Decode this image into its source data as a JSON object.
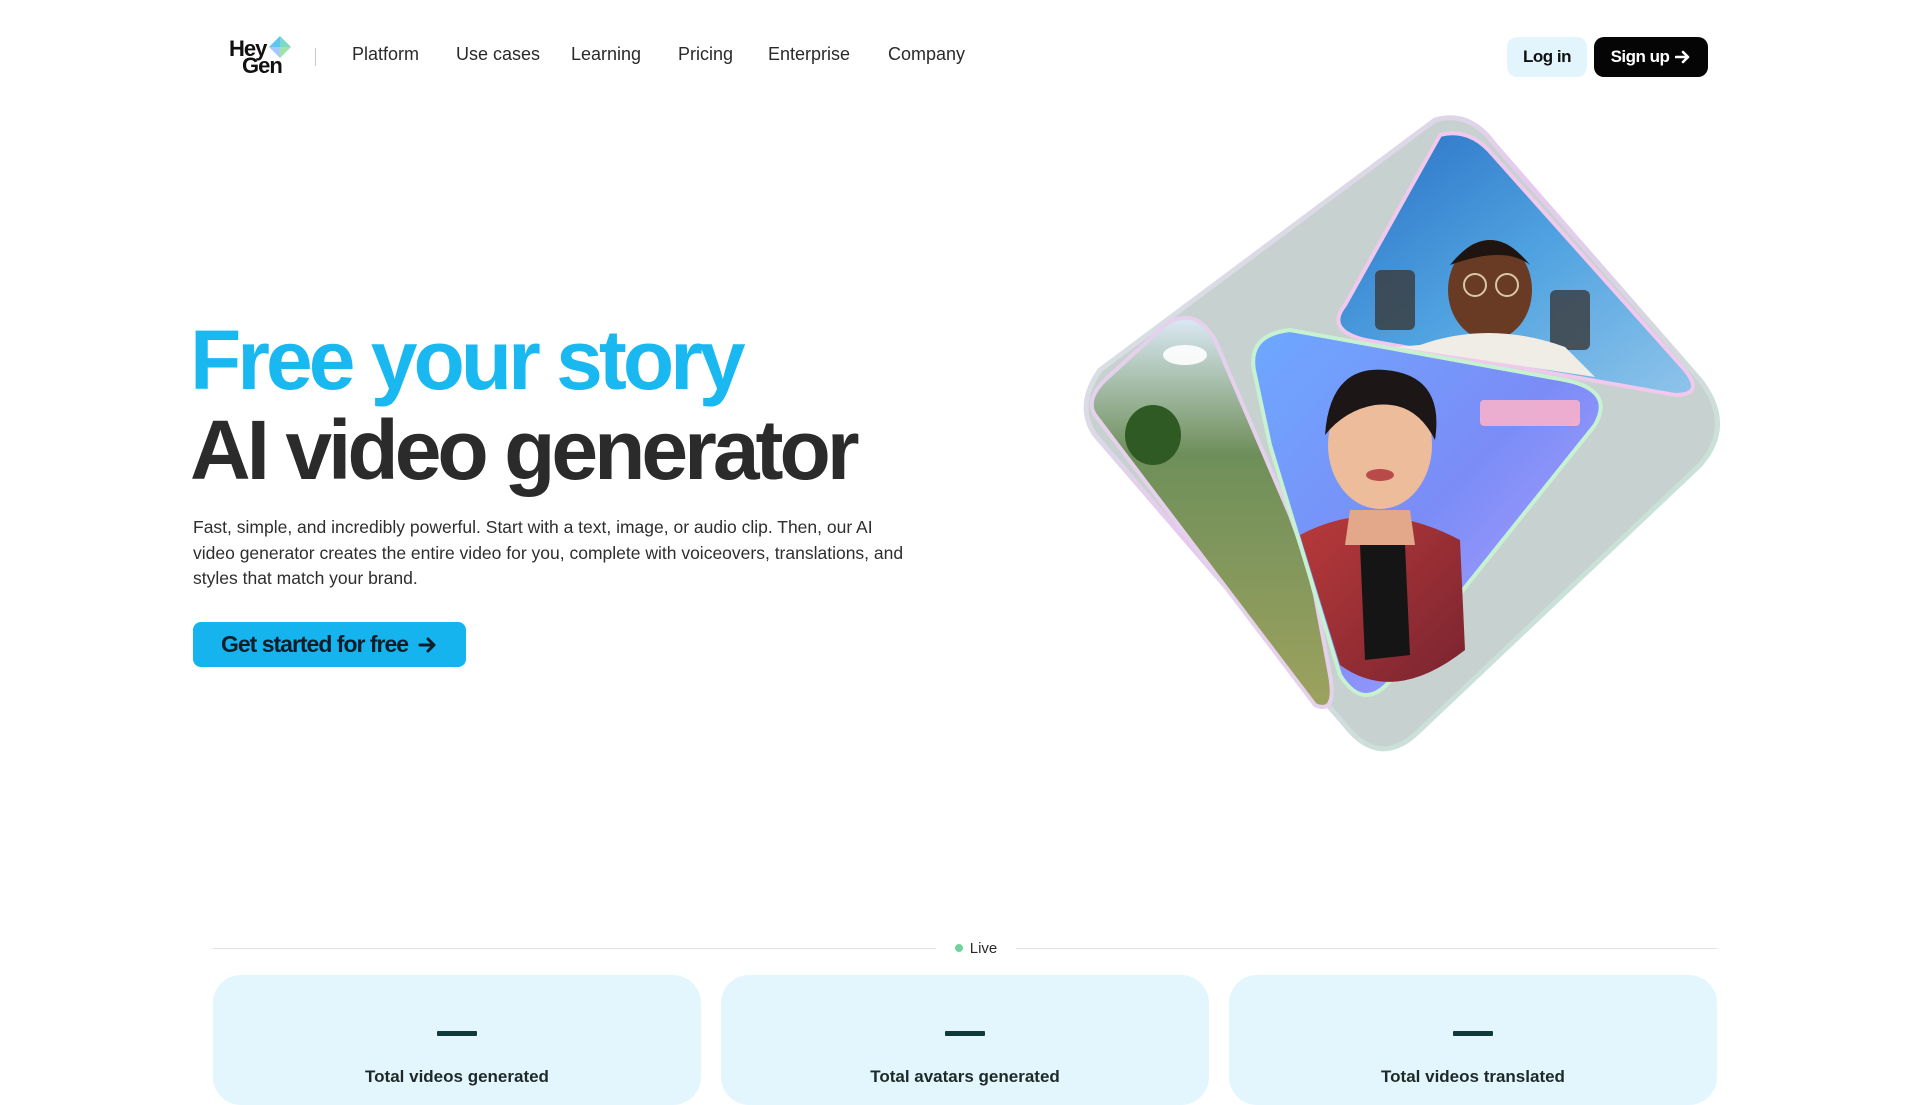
{
  "header": {
    "logo_line1": "Hey",
    "logo_line2": "Gen",
    "nav": [
      {
        "label": "Platform"
      },
      {
        "label": "Use cases"
      },
      {
        "label": "Learning"
      },
      {
        "label": "Pricing"
      },
      {
        "label": "Enterprise"
      },
      {
        "label": "Company"
      }
    ],
    "login_label": "Log in",
    "signup_label": "Sign up"
  },
  "hero": {
    "title_line1": "Free your story",
    "title_line2": "AI video generator",
    "description": "Fast, simple, and incredibly powerful. Start with a text, image, or audio clip. Then, our AI video generator creates the entire video for you, complete with voiceovers, translations, and styles that match your brand.",
    "cta_label": "Get started for free"
  },
  "stats": {
    "live_label": "Live",
    "cards": [
      {
        "value": "—",
        "label": "Total videos generated"
      },
      {
        "value": "—",
        "label": "Total avatars generated"
      },
      {
        "value": "—",
        "label": "Total videos translated"
      }
    ]
  },
  "colors": {
    "accent": "#15b4ef",
    "title_blue": "#1ab8f0",
    "card_bg": "#e3f6fd",
    "live_dot": "#6fd39a"
  }
}
